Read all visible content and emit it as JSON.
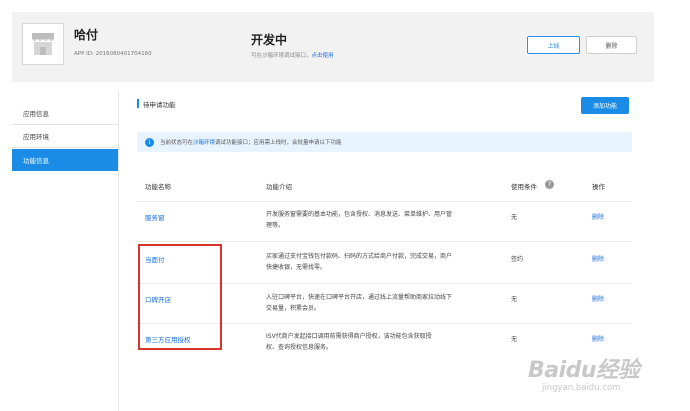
{
  "app": {
    "name": "哈付",
    "id_text": "APP ID: 2016080401704160",
    "status_title": "开发中",
    "status_sub_prefix": "可在沙箱环境调试接口，",
    "status_sub_link": "点击使用",
    "online_button": "上线",
    "delete_button": "删除"
  },
  "sidebar": {
    "items": [
      {
        "label": "应用信息",
        "active": false
      },
      {
        "label": "应用环境",
        "active": false
      },
      {
        "label": "功能信息",
        "active": true
      }
    ]
  },
  "main": {
    "section_title": "待申请功能",
    "add_button": "添加功能",
    "notice_prefix": "当前状态可在",
    "notice_link": "沙箱环境",
    "notice_suffix": "调试功能接口；应用需上线时，会批量申请以下功能",
    "columns": {
      "name": "功能名称",
      "desc": "功能介绍",
      "cond": "使用条件",
      "op": "操作"
    },
    "rows": [
      {
        "name": "服务窗",
        "desc_line1": "开发服务窗需要的基本功能，包含授权、消息发送、菜单维护、用户管",
        "desc_line2": "理等。",
        "cond": "无",
        "op": "删除"
      },
      {
        "name": "当面付",
        "desc_line1": "买家通过支付宝钱包付款码、扫码的方式给商户付款，完成交易，商户",
        "desc_line2": "快捷收银，无需找零。",
        "cond": "签约",
        "op": "删除"
      },
      {
        "name": "口碑开店",
        "desc_line1": "入驻口碑平台，快速在口碑平台开店，通过线上流量帮助商家拉动线下",
        "desc_line2": "交易量，积累会员。",
        "cond": "无",
        "op": "删除"
      },
      {
        "name": "第三方应用授权",
        "desc_line1": "ISV代商户发起接口调用前需获得商户授权，该功能包含获取授",
        "desc_line2": "权、查询授权信息服务。",
        "cond": "无",
        "op": "删除"
      }
    ]
  },
  "watermark": {
    "main": "Baidu经验",
    "sub": "jingyan.baidu.com"
  }
}
